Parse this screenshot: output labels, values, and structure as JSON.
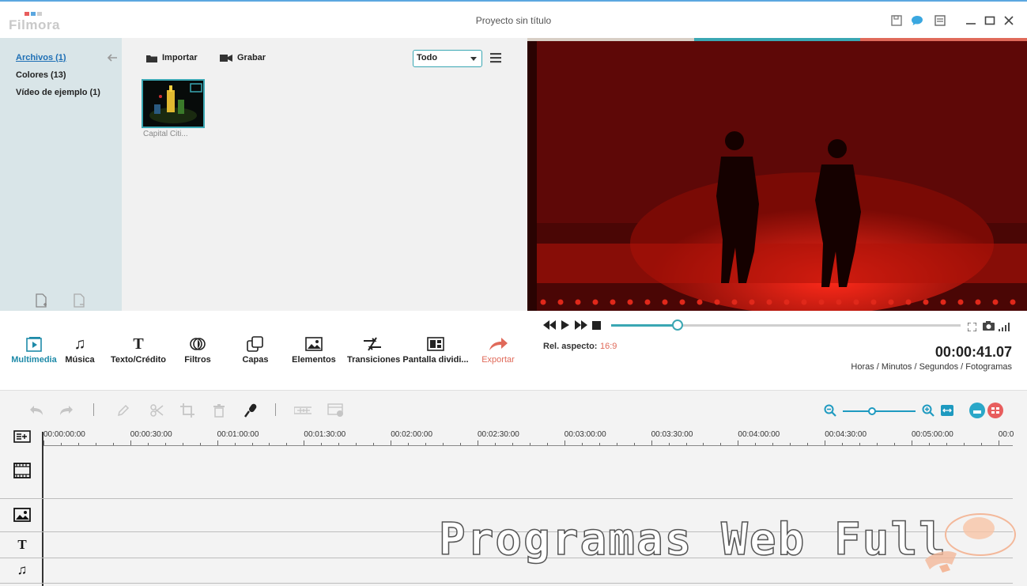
{
  "app": {
    "logo_text": "Filmora",
    "window_title": "Proyecto sin título",
    "brand_colors": [
      "#e85d5d",
      "#5ba7e0",
      "#e0e0e0"
    ]
  },
  "library": {
    "items": [
      {
        "label": "Archivos (1)",
        "active": true
      },
      {
        "label": "Colores (13)",
        "active": false
      },
      {
        "label": "Vídeo de ejemplo (1)",
        "active": false
      }
    ]
  },
  "media": {
    "import_label": "Importar",
    "record_label": "Grabar",
    "filter_value": "Todo",
    "clips": [
      {
        "caption": "Capital Citi..."
      }
    ]
  },
  "player": {
    "aspect_label": "Rel. aspecto:",
    "aspect_value": "16:9",
    "timecode": "00:00:41.07",
    "timecode_unit": "Horas / Minutos / Segundos / Fotogramas",
    "progress": 0.19
  },
  "ribbon": {
    "tools": [
      {
        "label": "Multimedia",
        "icon": "media-icon"
      },
      {
        "label": "Música",
        "icon": "music-icon"
      },
      {
        "label": "Texto/Crédito",
        "icon": "text-icon"
      },
      {
        "label": "Filtros",
        "icon": "filters-icon"
      },
      {
        "label": "Capas",
        "icon": "overlays-icon"
      },
      {
        "label": "Elementos",
        "icon": "elements-icon"
      },
      {
        "label": "Transiciones",
        "icon": "transitions-icon"
      },
      {
        "label": "Pantalla dividi...",
        "icon": "split-screen-icon"
      },
      {
        "label": "Exportar",
        "icon": "export-icon"
      }
    ]
  },
  "timeline": {
    "ticks": [
      "00:00:00:00",
      "00:00:30:00",
      "00:01:00:00",
      "00:01:30:00",
      "00:02:00:00",
      "00:02:30:00",
      "00:03:00:00",
      "00:03:30:00",
      "00:04:00:00",
      "00:04:30:00",
      "00:05:00:00",
      "00:0"
    ],
    "zoom_level": 0.4
  },
  "watermark": {
    "text": "Programas Web Full"
  }
}
